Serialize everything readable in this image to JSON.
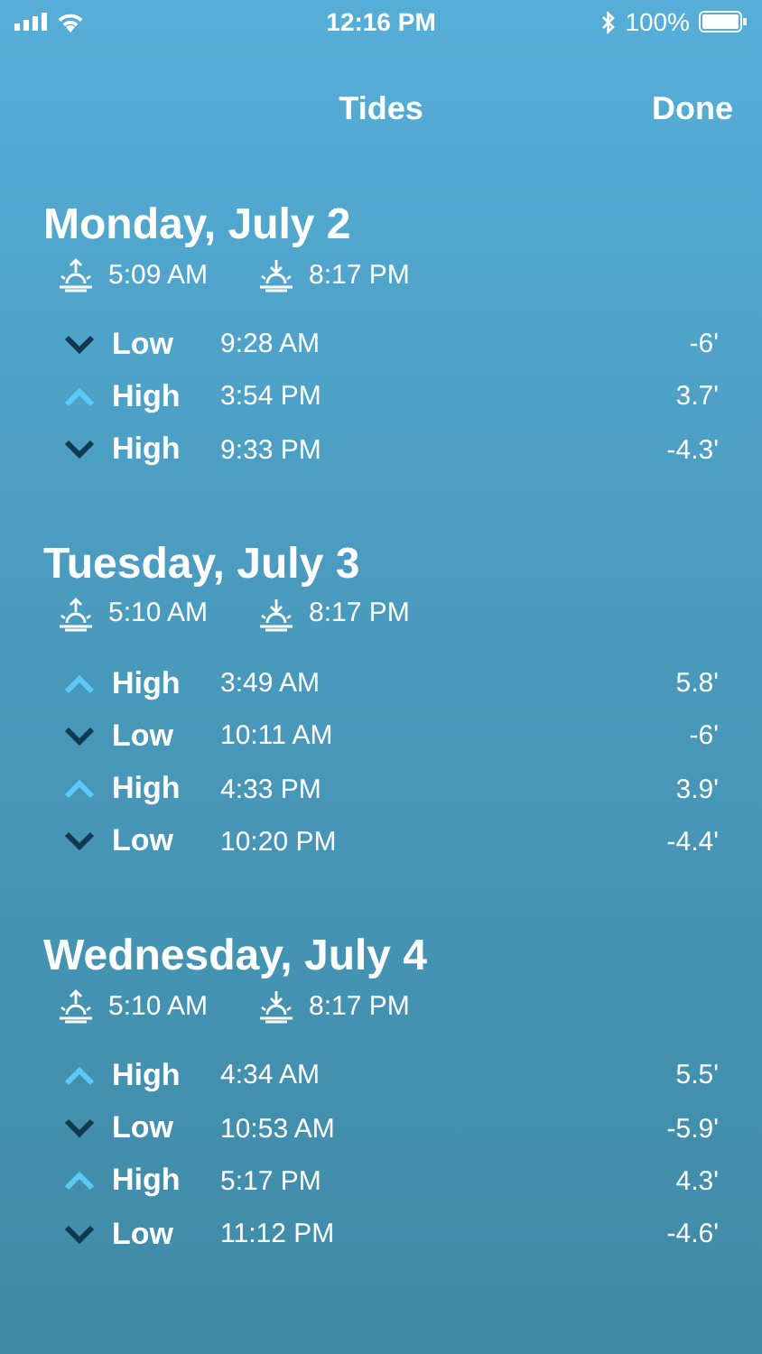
{
  "status_bar": {
    "time": "12:16 PM",
    "battery": "100%"
  },
  "nav": {
    "title": "Tides",
    "done": "Done"
  },
  "days": [
    {
      "title": "Monday, July 2",
      "sunrise": "5:09 AM",
      "sunset": "8:17 PM",
      "tides": [
        {
          "kind": "falling",
          "label": "Low",
          "time": "9:28 AM",
          "height": "-6'"
        },
        {
          "kind": "rising",
          "label": "High",
          "time": "3:54 PM",
          "height": "3.7'"
        },
        {
          "kind": "falling",
          "label": "High",
          "time": "9:33 PM",
          "height": "-4.3'"
        }
      ]
    },
    {
      "title": "Tuesday, July 3",
      "sunrise": "5:10 AM",
      "sunset": "8:17 PM",
      "tides": [
        {
          "kind": "rising",
          "label": "High",
          "time": "3:49 AM",
          "height": "5.8'"
        },
        {
          "kind": "falling",
          "label": "Low",
          "time": "10:11 AM",
          "height": "-6'"
        },
        {
          "kind": "rising",
          "label": "High",
          "time": "4:33 PM",
          "height": "3.9'"
        },
        {
          "kind": "falling",
          "label": "Low",
          "time": "10:20 PM",
          "height": "-4.4'"
        }
      ]
    },
    {
      "title": "Wednesday, July 4",
      "sunrise": "5:10 AM",
      "sunset": "8:17 PM",
      "tides": [
        {
          "kind": "rising",
          "label": "High",
          "time": "4:34 AM",
          "height": "5.5'"
        },
        {
          "kind": "falling",
          "label": "Low",
          "time": "10:53 AM",
          "height": "-5.9'"
        },
        {
          "kind": "rising",
          "label": "High",
          "time": "5:17 PM",
          "height": "4.3'"
        },
        {
          "kind": "falling",
          "label": "Low",
          "time": "11:12 PM",
          "height": "-4.6'"
        }
      ]
    }
  ]
}
